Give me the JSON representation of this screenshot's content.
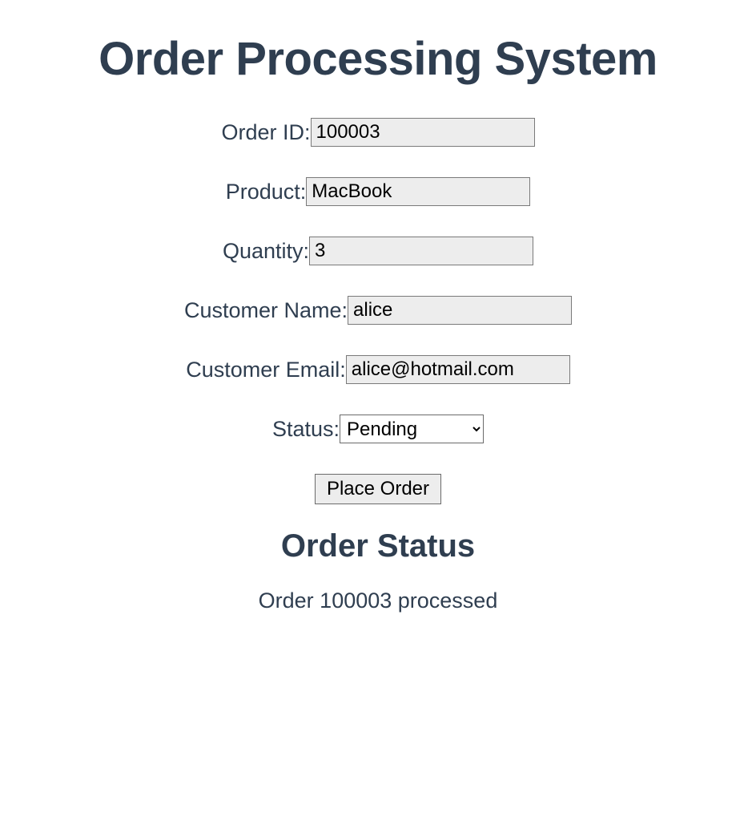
{
  "page": {
    "title": "Order Processing System"
  },
  "form": {
    "order_id": {
      "label": "Order ID:",
      "value": "100003"
    },
    "product": {
      "label": "Product:",
      "value": "MacBook"
    },
    "quantity": {
      "label": "Quantity:",
      "value": "3"
    },
    "customer_name": {
      "label": "Customer Name:",
      "value": "alice"
    },
    "customer_email": {
      "label": "Customer Email:",
      "value": "alice@hotmail.com"
    },
    "status": {
      "label": "Status:",
      "selected": "Pending",
      "options": [
        "Pending"
      ]
    },
    "submit_label": "Place Order"
  },
  "status_section": {
    "heading": "Order Status",
    "message": "Order 100003 processed"
  }
}
